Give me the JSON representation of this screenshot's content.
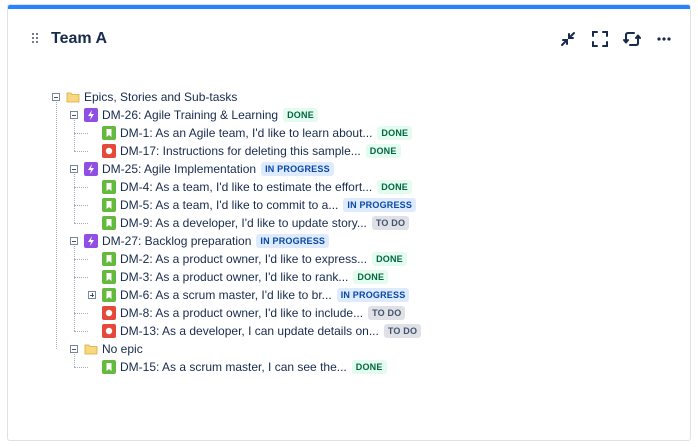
{
  "gadget": {
    "title": "Team A"
  },
  "colors": {
    "accent": "#2684ff",
    "epic": "#904ee2",
    "story": "#63ba3c",
    "bug": "#e5493a"
  },
  "tree": {
    "root": "Epics, Stories and Sub-tasks",
    "epics": [
      {
        "key": "DM-26",
        "text": "DM-26: Agile Training & Learning",
        "status": "DONE",
        "children": [
          {
            "text": "DM-1: As an Agile team, I'd like to learn about...",
            "status": "DONE",
            "type": "story"
          },
          {
            "text": "DM-17: Instructions for deleting this sample...",
            "status": "DONE",
            "type": "bug"
          }
        ]
      },
      {
        "key": "DM-25",
        "text": "DM-25: Agile Implementation",
        "status": "IN PROGRESS",
        "children": [
          {
            "text": "DM-4: As a team, I'd like to estimate the effort...",
            "status": "DONE",
            "type": "story"
          },
          {
            "text": "DM-5: As a team, I'd like to commit to a...",
            "status": "IN PROGRESS",
            "type": "story"
          },
          {
            "text": "DM-9: As a developer, I'd like to update story...",
            "status": "TO DO",
            "type": "story"
          }
        ]
      },
      {
        "key": "DM-27",
        "text": "DM-27: Backlog preparation",
        "status": "IN PROGRESS",
        "children": [
          {
            "text": "DM-2: As a product owner, I'd like to express...",
            "status": "DONE",
            "type": "story"
          },
          {
            "text": "DM-3: As a product owner, I'd like to rank...",
            "status": "DONE",
            "type": "story"
          },
          {
            "text": "DM-6: As a scrum master, I'd like to br...",
            "status": "IN PROGRESS",
            "type": "story",
            "collapsed": true
          },
          {
            "text": "DM-8: As a product owner, I'd like to include...",
            "status": "TO DO",
            "type": "bug"
          },
          {
            "text": "DM-13: As a developer, I can update details on...",
            "status": "TO DO",
            "type": "bug"
          }
        ]
      }
    ],
    "no_epic": {
      "text": "No epic",
      "children": [
        {
          "text": "DM-15: As a scrum master, I can see the...",
          "status": "DONE",
          "type": "story"
        }
      ]
    }
  }
}
